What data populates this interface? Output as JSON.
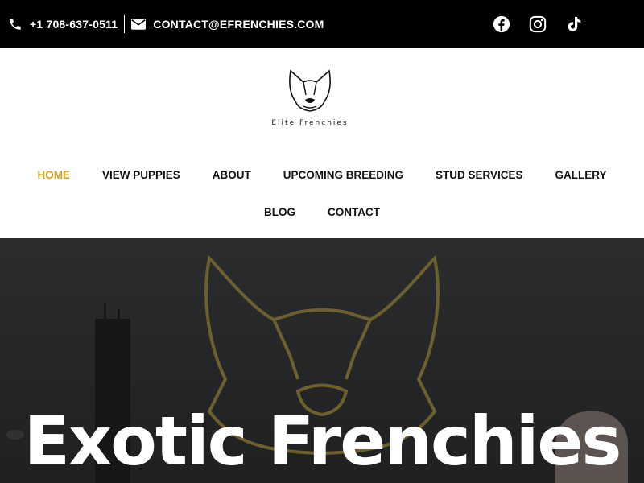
{
  "topbar": {
    "phone": "+1 708-637-0511",
    "email": "CONTACT@EFRENCHIES.COM",
    "social": [
      "facebook-icon",
      "instagram-icon",
      "tiktok-icon"
    ]
  },
  "logo": {
    "text": "Elite Frenchies"
  },
  "nav": {
    "row1": [
      "HOME",
      "VIEW PUPPIES",
      "ABOUT",
      "UPCOMING BREEDING",
      "STUD SERVICES",
      "GALLERY"
    ],
    "row2": [
      "BLOG",
      "CONTACT"
    ],
    "active": "HOME"
  },
  "hero": {
    "title": "Exotic Frenchies"
  },
  "colors": {
    "topbar_bg": "#000000",
    "accent": "#d3a022",
    "hero_bg": "#232425",
    "outline_gold": "#6e5f2e"
  }
}
